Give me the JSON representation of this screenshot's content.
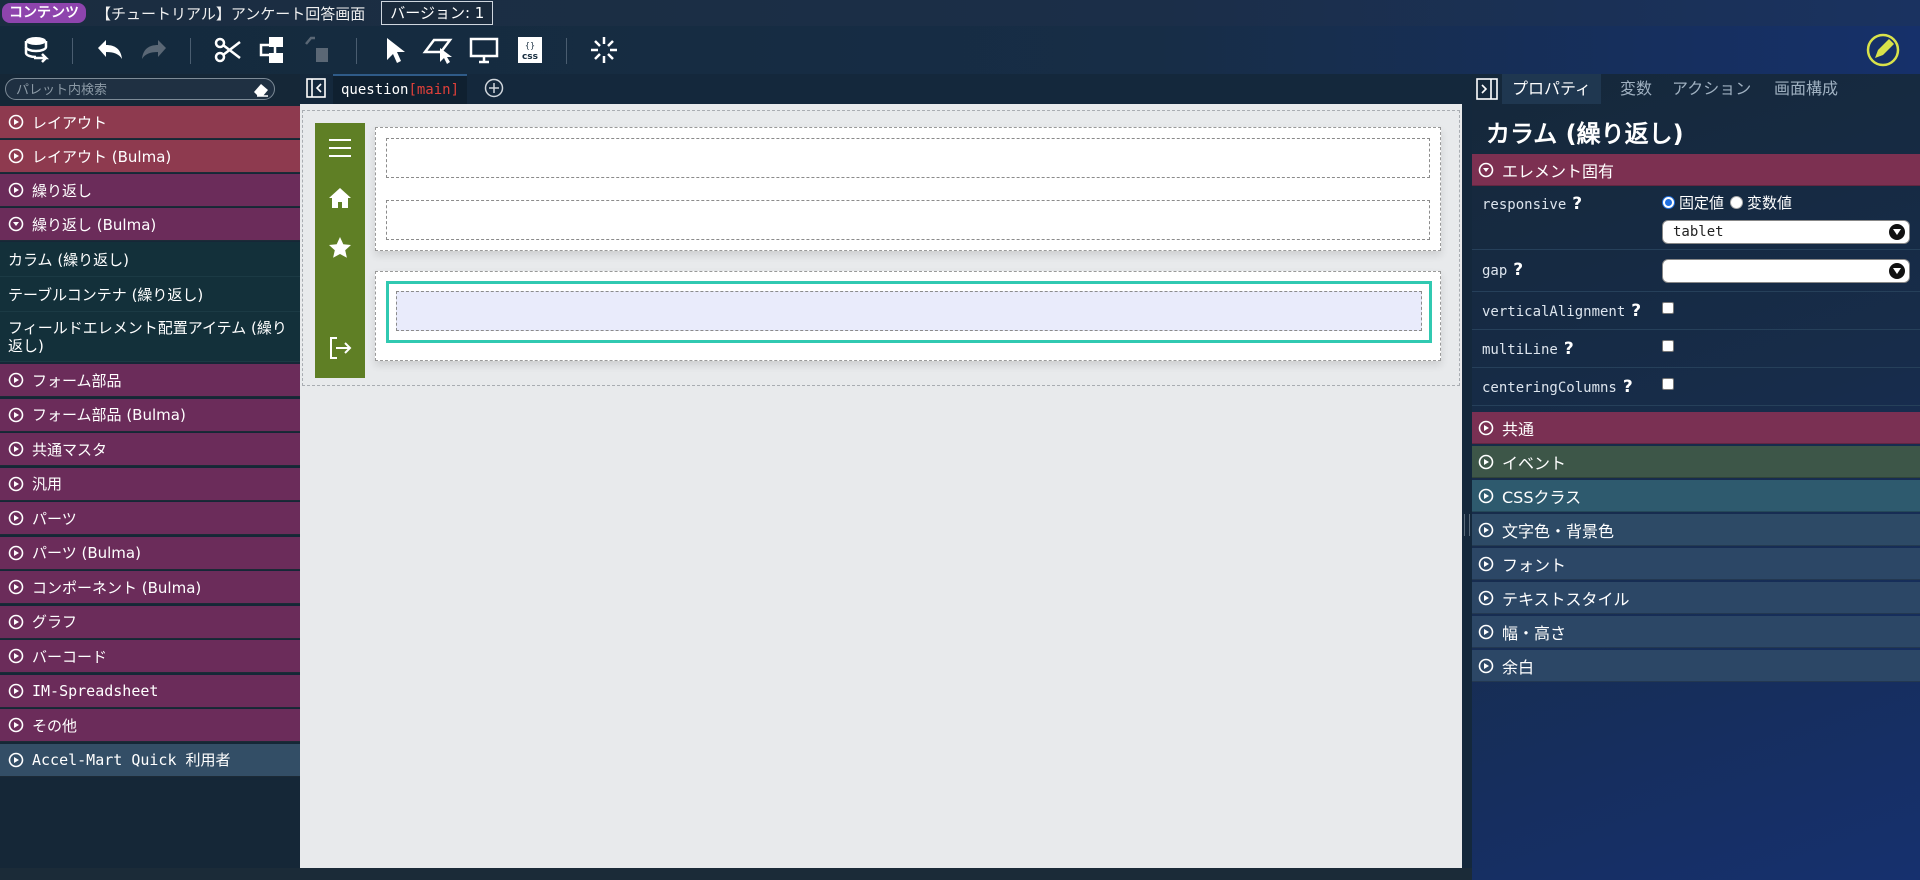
{
  "titlebar": {
    "badge": "コンテンツ",
    "title": "【チュートリアル】アンケート回答画面",
    "version": "バージョン: 1"
  },
  "toolbar": {
    "icons": [
      "database-icon",
      "undo-icon",
      "redo-icon",
      "cut-icon",
      "components-icon",
      "paste-icon",
      "pointer-icon",
      "preview-pointer-icon",
      "monitor-icon",
      "css-icon",
      "loading-icon",
      "edit-icon"
    ]
  },
  "palette": {
    "search_placeholder": "パレット内検索",
    "categories": [
      {
        "label": "レイアウト",
        "color": "red"
      },
      {
        "label": "レイアウト (Bulma)",
        "color": "red"
      },
      {
        "label": "繰り返し",
        "color": "purple"
      },
      {
        "label": "繰り返し (Bulma)",
        "color": "purple",
        "expanded": true
      }
    ],
    "sub_items": [
      "カラム (繰り返し)",
      "テーブルコンテナ (繰り返し)",
      "フィールドエレメント配置アイテム (繰り返し)"
    ],
    "more_categories": [
      {
        "label": "フォーム部品",
        "color": "purple"
      },
      {
        "label": "フォーム部品 (Bulma)",
        "color": "purple"
      },
      {
        "label": "共通マスタ",
        "color": "purple"
      },
      {
        "label": "汎用",
        "color": "purple"
      },
      {
        "label": "パーツ",
        "color": "purple"
      },
      {
        "label": "パーツ (Bulma)",
        "color": "purple"
      },
      {
        "label": "コンポーネント (Bulma)",
        "color": "purple"
      },
      {
        "label": "グラフ",
        "color": "purple"
      },
      {
        "label": "バーコード",
        "color": "purple"
      },
      {
        "label": "IM-Spreadsheet",
        "color": "purple"
      },
      {
        "label": "その他",
        "color": "purple"
      },
      {
        "label": "Accel-Mart Quick 利用者",
        "color": "blue"
      }
    ]
  },
  "canvas": {
    "tab_name": "question",
    "tab_tag": "[main]"
  },
  "props": {
    "tabs": [
      "プロパティ",
      "変数",
      "アクション",
      "画面構成"
    ],
    "active_tab": 0,
    "title": "カラム (繰り返し)",
    "element_section": "エレメント固有",
    "rows": {
      "responsive": {
        "label": "responsive",
        "option_fixed": "固定値",
        "option_var": "変数値",
        "value": "tablet"
      },
      "gap": {
        "label": "gap",
        "value": ""
      },
      "verticalAlignment": {
        "label": "verticalAlignment"
      },
      "multiLine": {
        "label": "multiLine"
      },
      "centeringColumns": {
        "label": "centeringColumns"
      }
    },
    "sections": [
      "共通",
      "イベント",
      "CSSクラス",
      "文字色・背景色",
      "フォント",
      "テキストスタイル",
      "幅・高さ",
      "余白"
    ]
  },
  "colors": {
    "nav_green": "#5f7f25",
    "selected_border": "#31c9b1",
    "palette_red": "#8e3a4f",
    "palette_purple": "#6b2c5a"
  }
}
